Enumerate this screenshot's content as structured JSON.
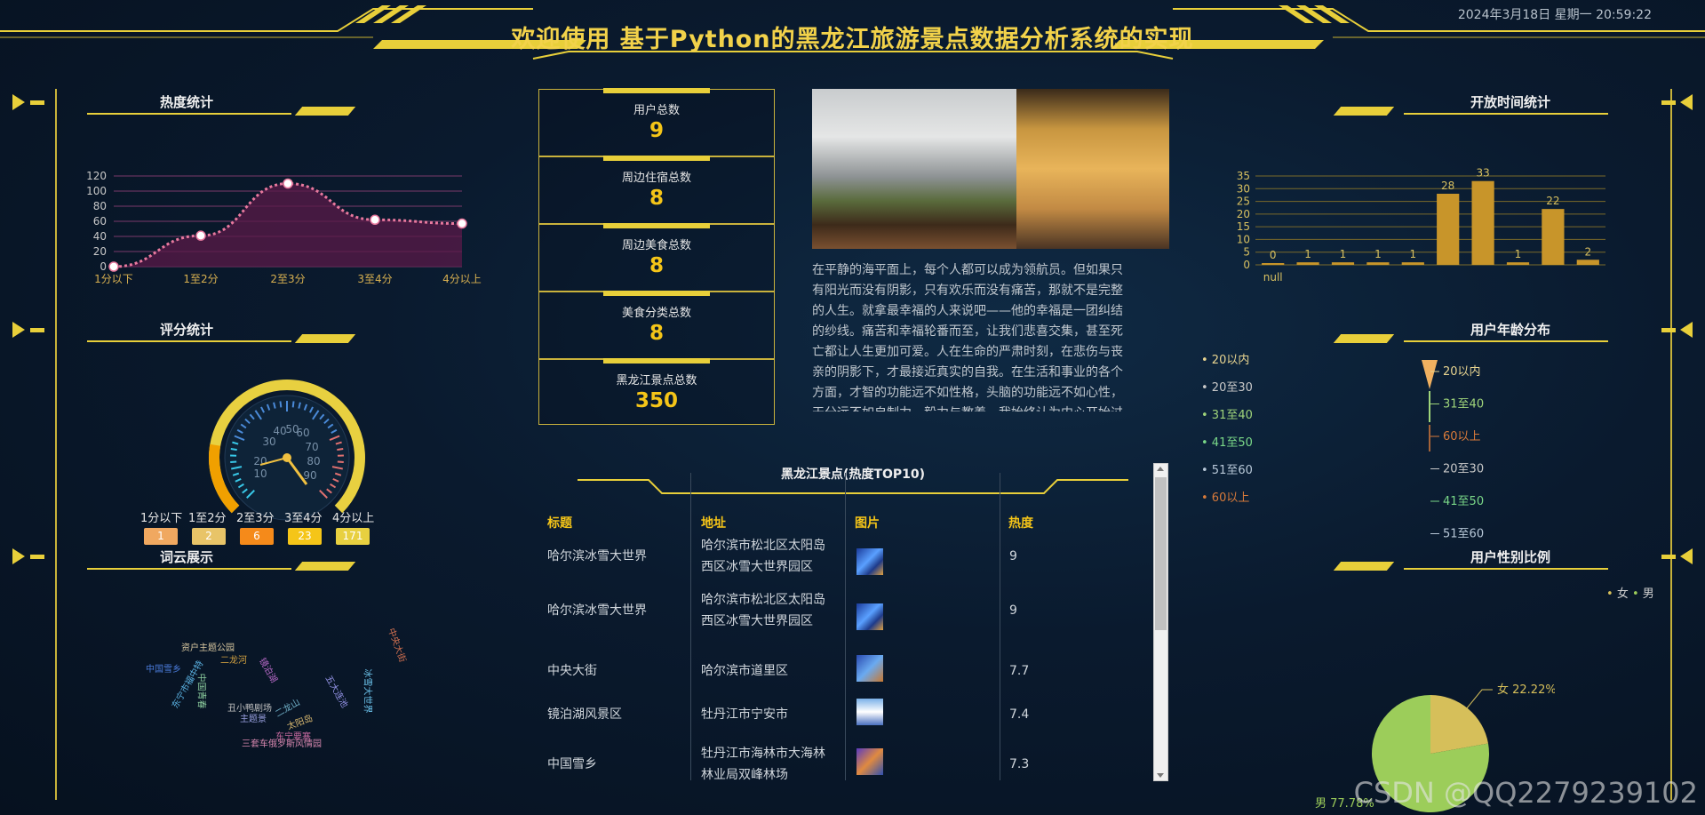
{
  "header": {
    "title": "欢迎使用 基于Python的黑龙江旅游景点数据分析系统的实现",
    "datetime": "2024年3月18日 星期一 20:59:22"
  },
  "panels": {
    "heat": "热度统计",
    "rating": "评分统计",
    "cloud": "词云展示",
    "open_time": "开放时间统计",
    "age": "用户年龄分布",
    "gender": "用户性别比例"
  },
  "stats": [
    {
      "label": "用户总数",
      "value": "9"
    },
    {
      "label": "周边住宿总数",
      "value": "8"
    },
    {
      "label": "周边美食总数",
      "value": "8"
    },
    {
      "label": "美食分类总数",
      "value": "8"
    },
    {
      "label": "黑龙江景点总数",
      "value": "350"
    }
  ],
  "article": "在平静的海平面上，每个人都可以成为领航员。但如果只有阳光而没有阴影，只有欢乐而没有痛苦，那就不是完整的人生。就拿最幸福的人来说吧——他的幸福是一团纠结的纱线。痛苦和幸福轮番而至，让我们悲喜交集，甚至死亡都让人生更加可爱。人在生命的严肃时刻，在悲伤与丧亲的阴影下，才最接近真实的自我。在生活和事业的各个方面，才智的功能远不如性格，头脑的功能远不如心性，天分远不如自制力、毅力与教养。我始终认为内心开始过严肃生活的人，他外在的生活会开始变得更为俭朴。",
  "table": {
    "title": "黑龙江景点(热度TOP10)",
    "headers": [
      "标题",
      "地址",
      "图片",
      "热度"
    ],
    "rows": [
      {
        "title": "哈尔滨冰雪大世界",
        "addr1": "哈尔滨市松北区太阳岛",
        "addr2": "西区冰雪大世界园区",
        "heat": "9"
      },
      {
        "title": "哈尔滨冰雪大世界",
        "addr1": "哈尔滨市松北区太阳岛",
        "addr2": "西区冰雪大世界园区",
        "heat": "9"
      },
      {
        "title": "中央大街",
        "addr1": "哈尔滨市道里区",
        "addr2": "",
        "heat": "7.7"
      },
      {
        "title": "镜泊湖风景区",
        "addr1": "牡丹江市宁安市",
        "addr2": "",
        "heat": "7.4"
      },
      {
        "title": "中国雪乡",
        "addr1": "牡丹江市海林市大海林",
        "addr2": "林业局双峰林场",
        "heat": "7.3"
      }
    ]
  },
  "rating_chart": {
    "ticks": [
      "30",
      "40",
      "50",
      "60",
      "70",
      "80",
      "90",
      "10",
      "20"
    ],
    "labels": [
      "1分以下",
      "1至2分",
      "2至3分",
      "3至4分",
      "4分以上"
    ],
    "values": [
      "1",
      "2",
      "6",
      "23",
      "171"
    ],
    "colors": [
      "#f0a860",
      "#e8c468",
      "#f58a1a",
      "#f5c518",
      "#e8d040"
    ]
  },
  "word_cloud": [
    {
      "text": "资户主题公园",
      "c": "#d9c8a0"
    },
    {
      "text": "中国雪乡",
      "c": "#4a7ad8"
    },
    {
      "text": "二龙河",
      "c": "#d0a040"
    },
    {
      "text": "东宁市福中特",
      "c": "#5ab0e0"
    },
    {
      "text": "中国青春",
      "c": "#8fd0a0"
    },
    {
      "text": "镜泊湖",
      "c": "#b86ac8"
    },
    {
      "text": "丑小鸭剧场",
      "c": "#c0c0c0"
    },
    {
      "text": "主题景",
      "c": "#9aa0e0"
    },
    {
      "text": "三套车俄罗斯风情园",
      "c": "#d888b0"
    },
    {
      "text": "东宁要塞",
      "c": "#c86aa0"
    },
    {
      "text": "中央大街",
      "c": "#d07050"
    },
    {
      "text": "冰雪大世界",
      "c": "#6ac0e8"
    },
    {
      "text": "五大连池",
      "c": "#8f8fe0"
    },
    {
      "text": "二龙山",
      "c": "#70b0c8"
    },
    {
      "text": "太阳岛",
      "c": "#d8b870"
    }
  ],
  "chart_data": [
    {
      "type": "area",
      "title": "热度统计",
      "categories": [
        "1分以下",
        "1至2分",
        "2至3分",
        "3至4分",
        "4分以上"
      ],
      "values": [
        0,
        41,
        110,
        62,
        57
      ],
      "ylim": [
        0,
        120
      ],
      "yticks": [
        0,
        20,
        40,
        60,
        80,
        100,
        120
      ],
      "colors": {
        "line": "#e8799e",
        "fill": "#5a1a48",
        "grid": "#7a3a6a"
      }
    },
    {
      "type": "bar",
      "title": "开放时间统计",
      "categories": [
        "null",
        "",
        "",
        "",
        "",
        "",
        "",
        "",
        ""
      ],
      "values": [
        0,
        1,
        1,
        1,
        1,
        28,
        33,
        1,
        22,
        2
      ],
      "ylim": [
        0,
        35
      ],
      "yticks": [
        0,
        5,
        10,
        15,
        20,
        25,
        30,
        35
      ],
      "bar_color": "#c8952a"
    },
    {
      "type": "pie",
      "title": "用户性别比例",
      "legend": [
        "女",
        "男"
      ],
      "values": [
        22.22,
        77.78
      ],
      "labels": [
        "女 22.22%",
        "男 77.78%"
      ],
      "colors": [
        "#d6bf5a",
        "#9ccd5a"
      ]
    },
    {
      "type": "funnel",
      "title": "用户年龄分布",
      "legend": [
        "20以内",
        "20至30",
        "31至40",
        "41至50",
        "51至60",
        "60以上"
      ],
      "legend_colors": [
        "#e8d490",
        "#c8c8c8",
        "#9fd47a",
        "#7ad888",
        "#b8c8d8",
        "#d87a3a"
      ],
      "labels": [
        "20以内",
        "31至40",
        "60以上",
        "20至30",
        "41至50",
        "51至60"
      ],
      "label_colors": [
        "#e8d490",
        "#9fd47a",
        "#d87a3a",
        "#c8c8c8",
        "#7ad888",
        "#b8c8d8"
      ]
    }
  ],
  "watermark": "CSDN @QQ2279239102"
}
